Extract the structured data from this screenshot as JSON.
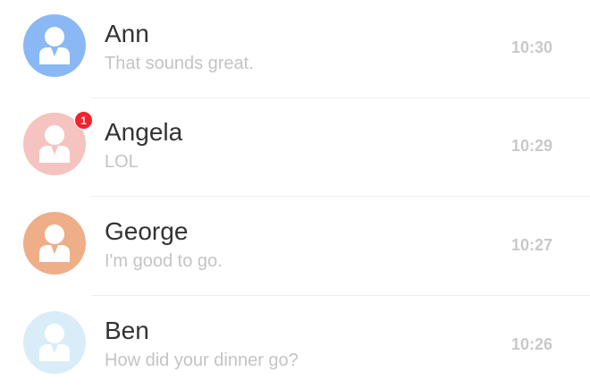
{
  "chats": [
    {
      "name": "Ann",
      "message": "That sounds great.",
      "time": "10:30",
      "avatar_color": "#8ab8f5",
      "avatar_icon": "user-icon",
      "unread": null
    },
    {
      "name": "Angela",
      "message": "LOL",
      "time": "10:29",
      "avatar_color": "#f5c4c0",
      "avatar_icon": "user-icon",
      "unread": "1"
    },
    {
      "name": "George",
      "message": "I'm good to go.",
      "time": "10:27",
      "avatar_color": "#eeae88",
      "avatar_icon": "user-icon",
      "unread": null
    },
    {
      "name": "Ben",
      "message": "How did your dinner go?",
      "time": "10:26",
      "avatar_color": "#d9edf8",
      "avatar_icon": "user-icon",
      "unread": null
    }
  ],
  "colors": {
    "badge": "#f5222d",
    "name_text": "#333333",
    "message_text": "#c4c4c4",
    "time_text": "#c9c9c9"
  }
}
